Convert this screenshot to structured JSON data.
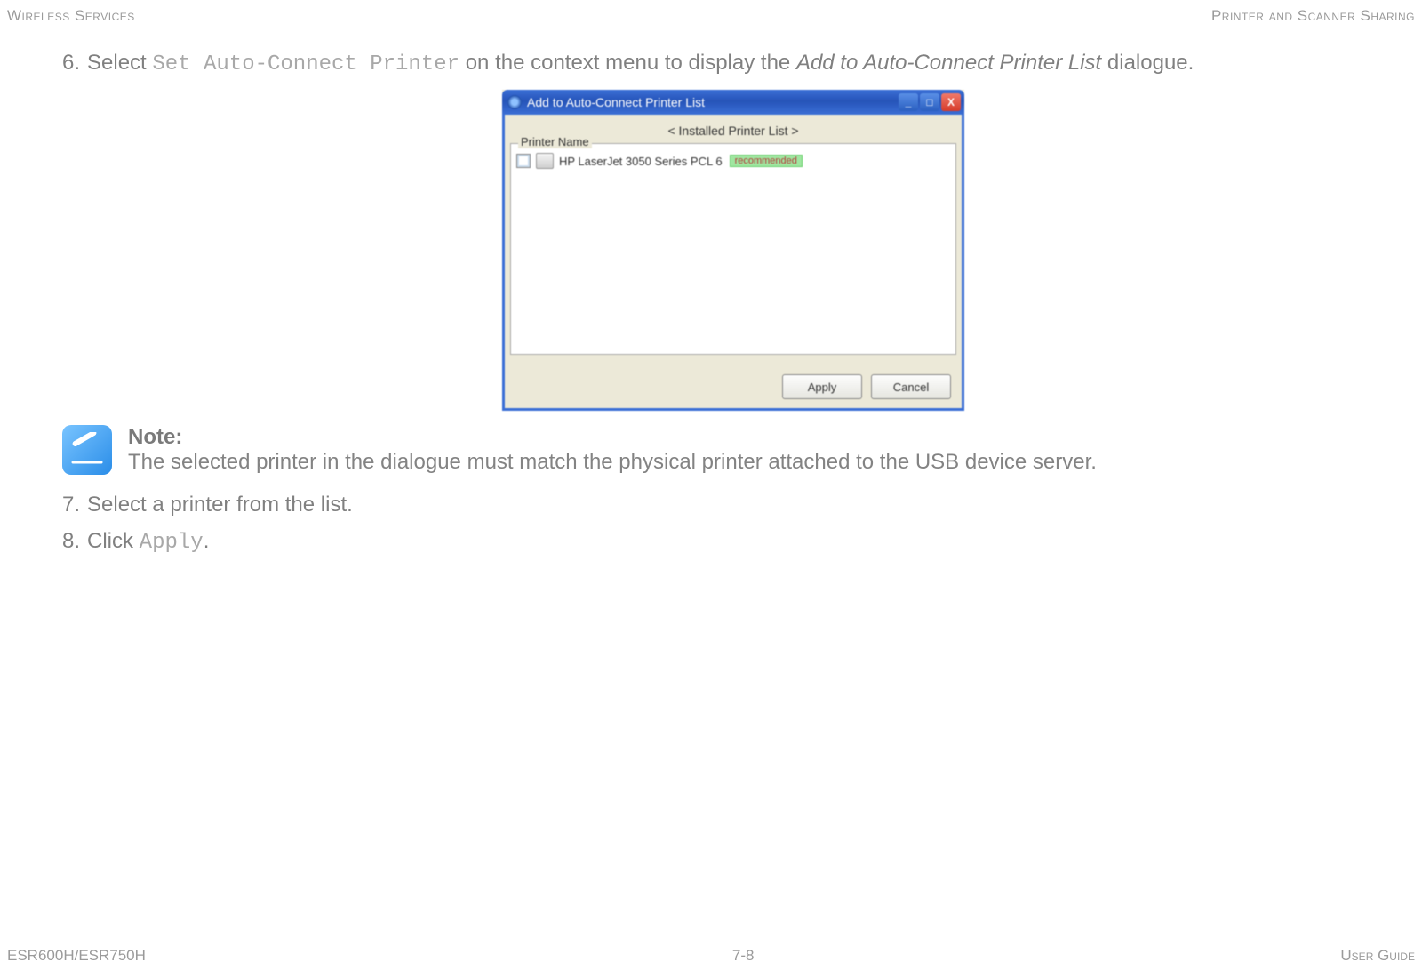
{
  "header": {
    "left": "Wireless Services",
    "right": "Printer and Scanner Sharing"
  },
  "footer": {
    "left": "ESR600H/ESR750H",
    "center": "7-8",
    "right": "User Guide"
  },
  "steps": {
    "six": {
      "num": "6.",
      "pre": "Select ",
      "code": "Set Auto-Connect Printer",
      "mid": " on the context menu to display the ",
      "italic": "Add to Auto-Connect Printer List",
      "post": " dialogue."
    },
    "seven": {
      "num": "7.",
      "text": "Select a printer from the list."
    },
    "eight": {
      "num": "8.",
      "pre": "Click ",
      "code": "Apply",
      "post": "."
    }
  },
  "dialog": {
    "title": "Add to Auto-Connect Printer List",
    "heading": "< Installed Printer List >",
    "column": "Printer Name",
    "row_printer": "HP LaserJet 3050 Series PCL 6",
    "row_badge": "recommended",
    "apply": "Apply",
    "cancel": "Cancel",
    "btn_min": "_",
    "btn_max": "□",
    "btn_close": "X"
  },
  "note": {
    "title": "Note:",
    "body": "The selected printer in the dialogue must match the physical printer attached to the USB device server."
  }
}
